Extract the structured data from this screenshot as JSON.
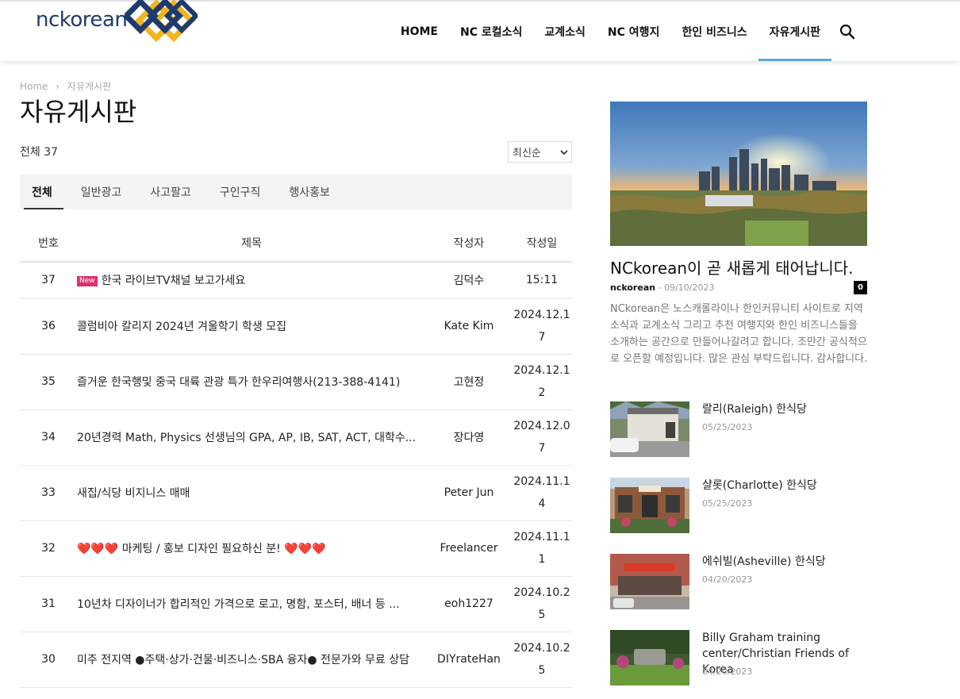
{
  "header": {
    "logo_text": "nckorean",
    "nav": [
      {
        "label": "HOME"
      },
      {
        "label": "NC 로컬소식"
      },
      {
        "label": "교계소식"
      },
      {
        "label": "NC 여행지"
      },
      {
        "label": "한인 비즈니스"
      },
      {
        "label": "자유게시판",
        "active": true
      }
    ],
    "search_icon": "search-icon"
  },
  "breadcrumb": {
    "home": "Home",
    "sep": "›",
    "current": "자유게시판"
  },
  "page": {
    "title": "자유게시판",
    "total_label": "전체 37",
    "sort_selected": "최신순"
  },
  "tabs": [
    {
      "label": "전체",
      "active": true
    },
    {
      "label": "일반광고"
    },
    {
      "label": "사고팔고"
    },
    {
      "label": "구인구직"
    },
    {
      "label": "행사홍보"
    }
  ],
  "table": {
    "columns": {
      "no": "번호",
      "title": "제목",
      "author": "작성자",
      "date": "작성일"
    },
    "new_badge": "New",
    "rows": [
      {
        "no": "37",
        "title": "한국 라이브TV채널 보고가세요",
        "author": "김덕수",
        "date": "15:11",
        "is_new": true
      },
      {
        "no": "36",
        "title": "콜럼비아 칼리지 2024년 겨울학기 학생 모집",
        "author": "Kate Kim",
        "date": "2024.12.17"
      },
      {
        "no": "35",
        "title": "즐거운 한국행및 중국 대륙 관광 특가 한우리여행사(213-388-4141)",
        "author": "고현정",
        "date": "2024.12.12"
      },
      {
        "no": "34",
        "title": "20년경력 Math, Physics 선생님의 GPA, AP, IB, SAT, ACT, 대학수...",
        "author": "장다영",
        "date": "2024.12.07"
      },
      {
        "no": "33",
        "title": "새집/식당 비지니스 매매",
        "author": "Peter Jun",
        "date": "2024.11.14"
      },
      {
        "no": "32",
        "title": "❤️❤️❤️ 마케팅 / 홍보 디자인 필요하신 분! ❤️❤️❤️",
        "author": "Freelancer",
        "date": "2024.11.11"
      },
      {
        "no": "31",
        "title": "10년차 디자이너가 합리적인 가격으로 로고, 명함, 포스터, 배너 등 ...",
        "author": "eoh1227",
        "date": "2024.10.25"
      },
      {
        "no": "30",
        "title": "미주 전지역 ●주택·상가·건물·비즈니스·SBA 융자● 전문가와 무료 상담",
        "author": "DIYrateHan",
        "date": "2024.10.25"
      }
    ]
  },
  "sidebar": {
    "hero": {
      "title": "NCkorean이 곧 새롭게 태어납니다.",
      "author": "nckorean",
      "meta_sep": "-",
      "date": "09/10/2023",
      "comments": "0",
      "excerpt": "NCkorean은 노스캐롤라이나 한인커뮤니티 사이트로 지역소식과 교계소식 그리고 추천 여행지와 한인 비즈니스들을 소개하는 공간으로 만들어나갈려고 합니다. 조만간 공식적으로 오픈할 예정입니다. 많은 관심 부탁드립니다. 감사합니다."
    },
    "posts": [
      {
        "title": "랄리(Raleigh) 한식당",
        "date": "05/25/2023"
      },
      {
        "title": "샬롯(Charlotte) 한식당",
        "date": "05/25/2023"
      },
      {
        "title": "에쉬빌(Asheville) 한식당",
        "date": "04/20/2023"
      },
      {
        "title": "Billy Graham training center/Christian Friends of Korea",
        "date": "04/20/2023"
      }
    ]
  }
}
